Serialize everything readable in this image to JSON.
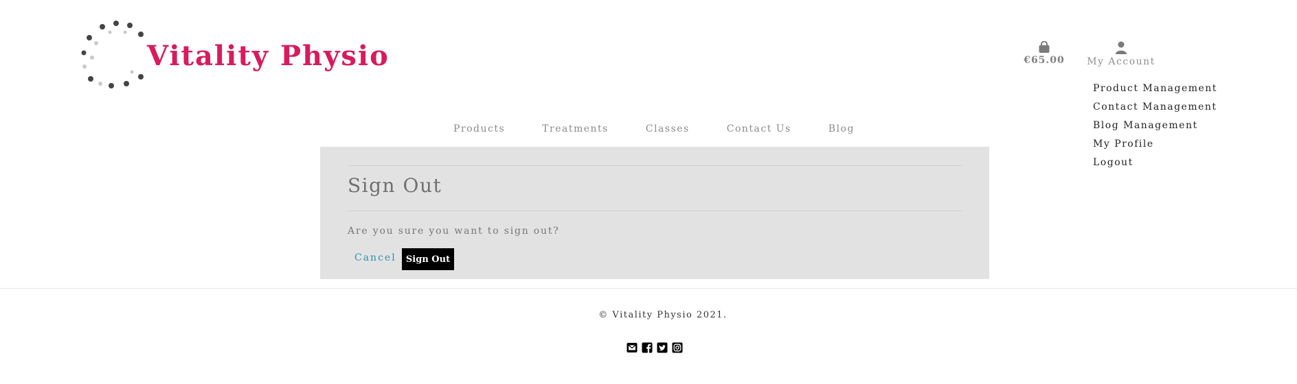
{
  "brand": {
    "name": "Vitality Physio"
  },
  "header": {
    "basket_total": "€65.00",
    "account_label": "My Account",
    "account_menu": [
      "Product Management",
      "Contact Management",
      "Blog Management",
      "My Profile",
      "Logout"
    ]
  },
  "nav": [
    "Products",
    "Treatments",
    "Classes",
    "Contact Us",
    "Blog"
  ],
  "main": {
    "title": "Sign Out",
    "message": "Are you sure you want to sign out?",
    "cancel_label": "Cancel",
    "signout_label": "Sign Out"
  },
  "footer": {
    "copyright": "© Vitality Physio 2021.",
    "social_icons": [
      "envelope-icon",
      "facebook-icon",
      "twitter-icon",
      "instagram-icon"
    ]
  },
  "colors": {
    "brand": "#d81b5e",
    "card_bg": "#e3e2e3",
    "link_accent": "#2a93a6",
    "button_bg": "#000000"
  }
}
